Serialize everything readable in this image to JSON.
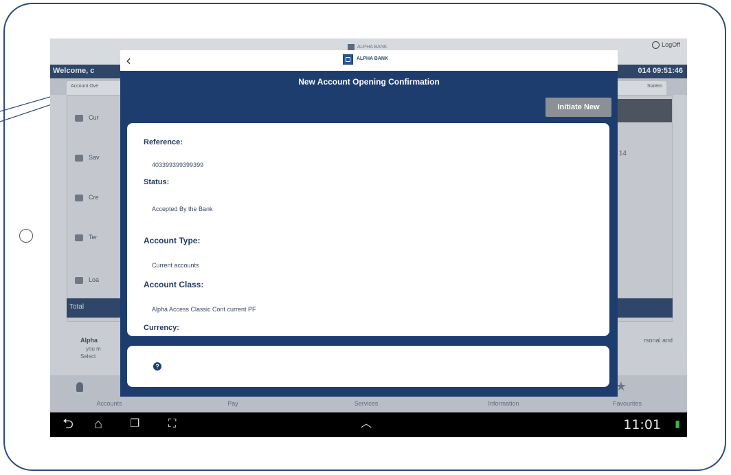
{
  "background_app": {
    "logo_text": "ALPHA BANK",
    "logoff_label": "LogOff",
    "welcome_text": "Welcome, c",
    "datetime": "014 09:51:46",
    "tab_left": "Account Ove",
    "tab_right": "Statem",
    "items": [
      {
        "label": "Cur"
      },
      {
        "label": "Sav"
      },
      {
        "label": "Cre"
      },
      {
        "label": "Ter"
      },
      {
        "label": "Loa"
      }
    ],
    "right_number": "14",
    "total_label": "Total",
    "info_line1": "Alpha",
    "info_line2": "you m",
    "info_line3": "Select",
    "info_right": "rsonal and",
    "nav": [
      "Accounts",
      "Pay",
      "Services",
      "Information",
      "Favourites"
    ]
  },
  "dialog": {
    "back_icon": "‹",
    "brand_text": "ALPHA BANK",
    "title": "New Account Opening Confirmation",
    "initiate_new_label": "Initiate New",
    "fields": {
      "reference_label": "Reference:",
      "reference_value": "403399399399399",
      "status_label": "Status:",
      "status_value": "Accepted By the Bank",
      "account_type_label": "Account Type:",
      "account_type_value": "Current accounts",
      "account_class_label": "Account Class:",
      "account_class_value": "Alpha Access Classic Cont current PF",
      "currency_label": "Currency:"
    },
    "help_icon": "?"
  },
  "system_bar": {
    "clock": "11:01"
  },
  "colors": {
    "dialog_bg": "#1e3d6f",
    "button_gray": "#8b9097",
    "frame": "#2b4a7a"
  }
}
